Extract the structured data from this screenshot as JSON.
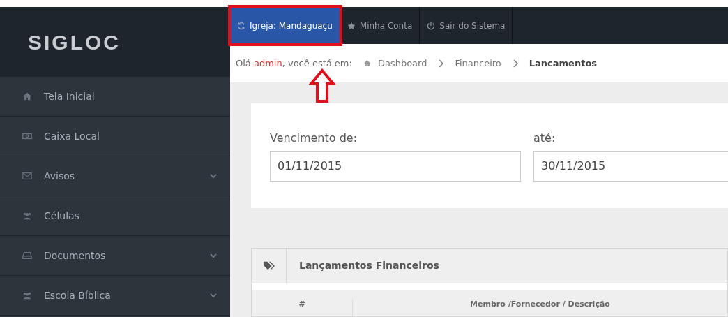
{
  "logo": {
    "text": "SIGLOC"
  },
  "topbar": {
    "items": [
      {
        "label": "Igreja: Mandaguaçu",
        "selected": true,
        "highlighted": true
      },
      {
        "label": "Minha Conta",
        "selected": false,
        "highlighted": false
      },
      {
        "label": "Sair do Sistema",
        "selected": false,
        "highlighted": false
      }
    ]
  },
  "breadcrumb": {
    "greeting": "Olá ",
    "user": "admin",
    "suffix": ", você está em:",
    "items": [
      {
        "label": "Dashboard",
        "current": false
      },
      {
        "label": "Financeiro",
        "current": false
      },
      {
        "label": "Lancamentos",
        "current": true
      }
    ]
  },
  "sidebar": {
    "items": [
      {
        "label": "Tela Inicial",
        "expandable": false
      },
      {
        "label": "Caixa Local",
        "expandable": false
      },
      {
        "label": "Avisos",
        "expandable": true
      },
      {
        "label": "Células",
        "expandable": false
      },
      {
        "label": "Documentos",
        "expandable": true
      },
      {
        "label": "Escola Bíblica",
        "expandable": true
      }
    ]
  },
  "filter": {
    "from_label": "Vencimento de:",
    "from_value": "01/11/2015",
    "to_label": "até:",
    "to_value": "30/11/2015"
  },
  "panel": {
    "title": "Lançamentos Financeiros",
    "columns": [
      "#",
      "Membro /Fornecedor / Descrição"
    ]
  }
}
